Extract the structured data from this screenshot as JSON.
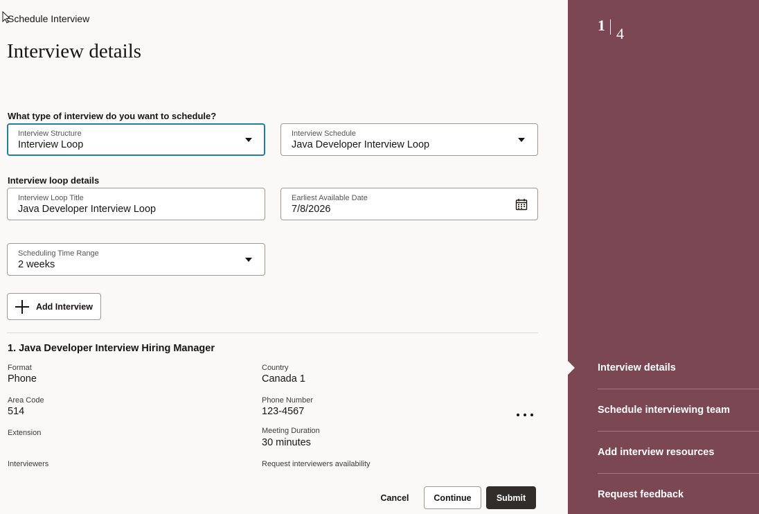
{
  "app": {
    "title": "Schedule Interview"
  },
  "page": {
    "title": "Interview details"
  },
  "type_section": {
    "label": "What type of interview do you want to schedule?"
  },
  "structure": {
    "label": "Interview Structure",
    "value": "Interview Loop"
  },
  "schedule": {
    "label": "Interview Schedule",
    "value": "Java Developer Interview Loop"
  },
  "loop_section": {
    "label": "Interview loop details"
  },
  "loop_title": {
    "label": "Interview Loop Title",
    "value": "Java Developer Interview Loop"
  },
  "earliest_date": {
    "label": "Earliest Available Date",
    "value": "7/8/2026"
  },
  "time_range": {
    "label": "Scheduling Time Range",
    "value": "2 weeks"
  },
  "add_interview": {
    "label": "Add Interview"
  },
  "interview": {
    "title": "1. Java Developer Interview Hiring Manager",
    "format_label": "Format",
    "format_value": "Phone",
    "country_label": "Country",
    "country_value": "Canada 1",
    "area_code_label": "Area Code",
    "area_code_value": "514",
    "phone_label": "Phone Number",
    "phone_value": "123-4567",
    "extension_label": "Extension",
    "duration_label": "Meeting Duration",
    "duration_value": "30 minutes",
    "interviewers_label": "Interviewers",
    "availability_label": "Request interviewers availability"
  },
  "actions": {
    "cancel": "Cancel",
    "continue": "Continue",
    "submit": "Submit"
  },
  "train": {
    "current": "1",
    "total": "4",
    "steps": [
      {
        "label": "Interview details"
      },
      {
        "label": "Schedule interviewing team"
      },
      {
        "label": "Add interview resources"
      },
      {
        "label": "Request feedback"
      }
    ]
  },
  "icons": {
    "calendar": "calendar-icon",
    "more": "more-horizontal-icon",
    "add": "plus-icon",
    "dropdown": "chevron-down-icon"
  },
  "colors": {
    "sidebar": "#7b4752",
    "focus": "#227e9e",
    "primary_button": "#312d2a"
  }
}
